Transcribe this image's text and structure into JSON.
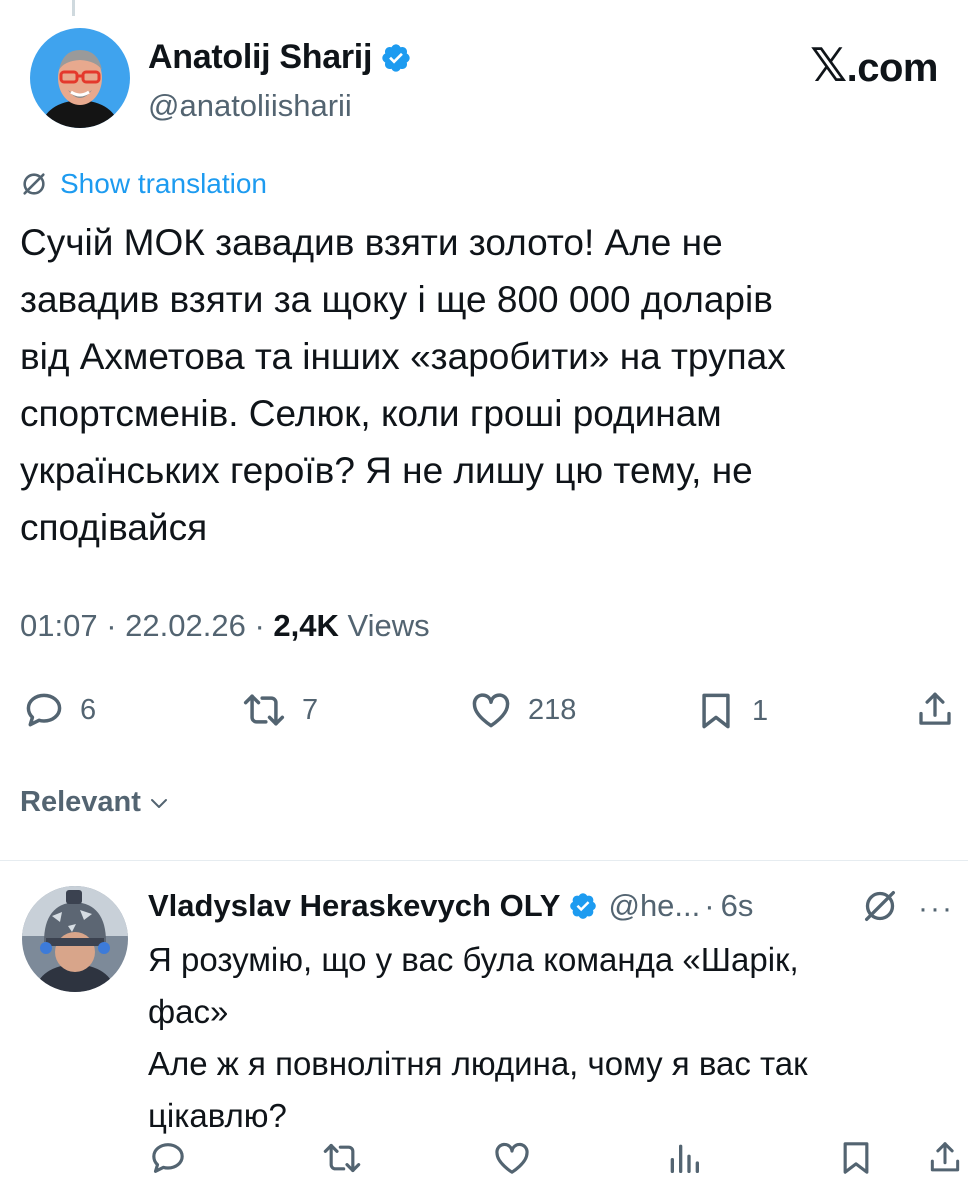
{
  "brand": {
    "text": ".com",
    "x_glyph": "𝕏"
  },
  "author": {
    "name": "Anatolij Sharij",
    "handle": "@anatoliisharii",
    "verified": true
  },
  "translation": {
    "label": "Show translation",
    "icon": "translate-icon"
  },
  "tweet": {
    "text": "Сучій МОК завадив взяти золото! Але не\nзавадив взяти за щоку і ще 800 000 доларів\nвід Ахметова та інших «заробити» на трупах\nспортсменів. Селюк, коли гроші родинам\nукраїнських героїв? Я не лишу цю тему, не\nсподівайся",
    "time": "01:07",
    "date": "22.02.26",
    "views_count": "2,4K",
    "views_label": "Views"
  },
  "actions": {
    "replies": "6",
    "reposts": "7",
    "likes": "218",
    "bookmarks": "1"
  },
  "sort": {
    "label": "Relevant"
  },
  "reply": {
    "name": "Vladyslav Heraskevych OLY",
    "handle": "@he...",
    "age": "6s",
    "separator": "·",
    "more": "···",
    "verified": true,
    "text": "Я розумію, що у вас була команда «Шарік,\nфас»\nАле ж я повнолітня людина, чому я вас так\nцікавлю?"
  },
  "colors": {
    "accent": "#1d9bf0",
    "text": "#0f1419",
    "secondary": "#536471",
    "divider": "#e6ecf0"
  }
}
